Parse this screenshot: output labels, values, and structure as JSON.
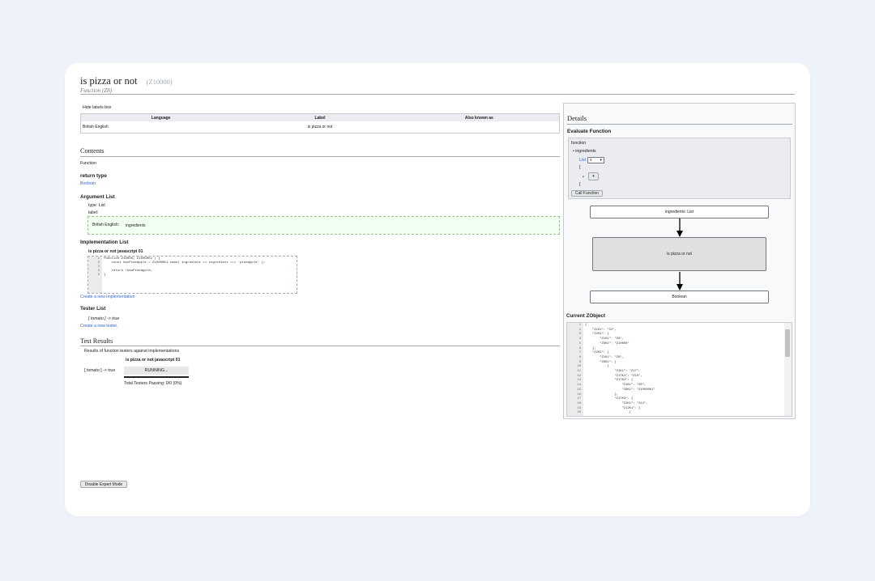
{
  "page": {
    "title": "is pizza or not",
    "zid": "(Z10000)",
    "subtitle": "Function (Z8)"
  },
  "labels": {
    "toggle": "Hide labels box",
    "headers": [
      "Language",
      "Label",
      "Also known as"
    ],
    "row": {
      "language": "British English",
      "label": "is pizza or not",
      "aka": ""
    }
  },
  "contents": {
    "heading": "Contents",
    "type_text": "Function",
    "return_type_heading": "return type",
    "return_type_value": "Boolean",
    "argument_heading": "Argument List",
    "arg_type": "type: List",
    "arg_label": "label:",
    "arg_lang": "British English:",
    "arg_name": "ingredients",
    "impl_heading": "Implementation List",
    "impl_name": "is pizza or not javascript 01",
    "code_lines": [
      {
        "n": "1",
        "t": "function Z10000( Z10000K1 ) {"
      },
      {
        "n": "2",
        "t": "    const hasPineapple = Z10000K1.some( ingredient => ingredient === 'pineapple' );"
      },
      {
        "n": "3",
        "t": ""
      },
      {
        "n": "4",
        "t": "    return !hasPineapple;"
      },
      {
        "n": "5",
        "t": "}"
      }
    ],
    "create_impl": "Create a new implementation",
    "tester_heading": "Tester List",
    "tester_item": "[ tomato ] -> true",
    "create_tester": "Create a new tester."
  },
  "tests": {
    "heading": "Test Results",
    "description": "Results of function testers against implementations",
    "impl_col": "is pizza or not javascript 01",
    "row_label": "[ tomato ] -> true",
    "status": "RUNNING...",
    "total": "Total Testers Passing: 0/0 (0%)"
  },
  "expert_button": "Disable Expert Mode",
  "details": {
    "heading": "Details",
    "eval_heading": "Evaluate Function",
    "function_label": "function",
    "arg_item": "ingredients",
    "list_label": "List",
    "list_select": "x",
    "bracket_open": "[",
    "bracket_close": "]",
    "add_symbol": "+",
    "call_button": "Call Function",
    "flow_input": "ingredients: List",
    "flow_function": "is pizza or not",
    "flow_output": "Boolean",
    "zobject_heading": "Current ZObject",
    "json_lines": [
      {
        "n": "1",
        "t": "{"
      },
      {
        "n": "2",
        "t": "    \"Z1K1\": \"Z2\","
      },
      {
        "n": "3",
        "t": "    \"Z2K1\": {"
      },
      {
        "n": "4",
        "t": "        \"Z1K1\": \"Z6\","
      },
      {
        "n": "5",
        "t": "        \"Z6K1\": \"Z10000\""
      },
      {
        "n": "6",
        "t": "    },"
      },
      {
        "n": "7",
        "t": "    \"Z2K2\": {"
      },
      {
        "n": "8",
        "t": "        \"Z1K1\": \"Z8\","
      },
      {
        "n": "9",
        "t": "        \"Z8K1\": ["
      },
      {
        "n": "10",
        "t": "            {"
      },
      {
        "n": "11",
        "t": "                \"Z1K1\": \"Z17\","
      },
      {
        "n": "12",
        "t": "                \"Z17K1\": \"Z10\","
      },
      {
        "n": "13",
        "t": "                \"Z17K2\": {"
      },
      {
        "n": "14",
        "t": "                    \"Z1K1\": \"Z6\","
      },
      {
        "n": "15",
        "t": "                    \"Z6K1\": \"Z10000K1\""
      },
      {
        "n": "16",
        "t": "                },"
      },
      {
        "n": "17",
        "t": "                \"Z17K3\": {"
      },
      {
        "n": "18",
        "t": "                    \"Z1K1\": \"Z12\","
      },
      {
        "n": "19",
        "t": "                    \"Z12K1\": ["
      },
      {
        "n": "20",
        "t": "                        {"
      }
    ]
  }
}
